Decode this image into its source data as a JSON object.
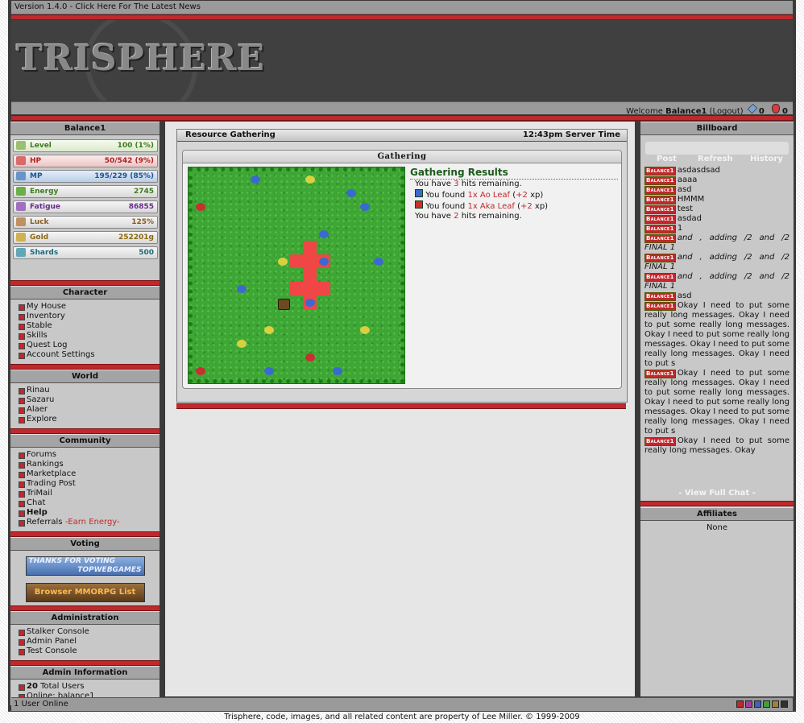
{
  "topbar": {
    "version_text": "Version 1.4.0 - Click Here For The Latest News"
  },
  "header": {
    "logo_text": "TRISPHERE"
  },
  "welcome": {
    "prefix": "Welcome",
    "user": "Balance1",
    "logout": "(Logout)",
    "crystal_count": "0",
    "potion_count": "0"
  },
  "left": {
    "player_name": "Balance1",
    "stats": [
      {
        "name": "Level",
        "value": "100 (1%)",
        "color": "#3e7a1e",
        "bg": "#e9f5dc"
      },
      {
        "name": "HP",
        "value": "50/542 (9%)",
        "color": "#b02020",
        "bg": "#f5d8d8"
      },
      {
        "name": "MP",
        "value": "195/229 (85%)",
        "color": "#24508c",
        "bg": "#cfe0f2"
      },
      {
        "name": "Energy",
        "value": "2745",
        "color": "#3e7a1e",
        "bg": "#e4efdc"
      },
      {
        "name": "Fatigue",
        "value": "86855",
        "color": "#6a2a8a",
        "bg": "#e6dcef"
      },
      {
        "name": "Luck",
        "value": "125%",
        "color": "#8a5a20",
        "bg": "#efe6dc"
      },
      {
        "name": "Gold",
        "value": "252201g",
        "color": "#8a6a10",
        "bg": "#efeadc"
      },
      {
        "name": "Shards",
        "value": "500",
        "color": "#1a6a7a",
        "bg": "#dcecef"
      }
    ],
    "character": {
      "title": "Character",
      "items": [
        "My House",
        "Inventory",
        "Stable",
        "Skills",
        "Quest Log",
        "Account Settings"
      ]
    },
    "world": {
      "title": "World",
      "items": [
        "Rinau",
        "Sazaru",
        "Alaer",
        "Explore"
      ]
    },
    "community": {
      "title": "Community",
      "items": [
        "Forums",
        "Rankings",
        "Marketplace",
        "Trading Post",
        "TriMail",
        "Chat",
        "Help",
        "Referrals"
      ],
      "referral_note": "-Earn Energy-"
    },
    "voting": {
      "title": "Voting",
      "banner1_line1": "THANKS FOR VOTING",
      "banner1_line2": "TOPWEBGAMES",
      "banner2": "Browser MMORPG List"
    },
    "administration": {
      "title": "Administration",
      "items": [
        "Stalker Console",
        "Admin Panel",
        "Test Console"
      ]
    },
    "admin_info": {
      "title": "Admin Information",
      "total_users_count": "20",
      "total_users_label": "Total Users",
      "online_label": "Online: balance1"
    }
  },
  "center": {
    "title": "Resource Gathering",
    "server_time": "12:43pm Server Time",
    "box_title": "Gathering",
    "results_title": "Gathering Results",
    "line1_pre": "You have",
    "line1_num": "3",
    "line1_post": "hits remaining.",
    "find1_pre": "You found",
    "find1_item": "1x Ao Leaf",
    "find1_open": "(",
    "find1_xp": "+2",
    "find1_post": "xp)",
    "find2_pre": "You found",
    "find2_item": "1x Aka Leaf",
    "find2_open": "(",
    "find2_xp": "+2",
    "find2_post": "xp)",
    "line2_pre": "You have",
    "line2_num": "2",
    "line2_post": "hits remaining."
  },
  "billboard": {
    "title": "Billboard",
    "tabs": [
      "Post",
      "Refresh",
      "History"
    ],
    "tag": "Balance1",
    "messages": [
      "asdasdsad",
      "aaaa",
      "asd",
      "HMMM",
      "test",
      "asdad",
      "1",
      "and , adding /2 and /2 FINAL 1",
      "and , adding /2 and /2 FINAL 1",
      "and , adding /2 and /2 FINAL 1",
      "asd",
      "Okay I need to put some really long messages. Okay I need to put some really long messages. Okay I need to put some really long messages. Okay I need to put some really long messages. Okay I need to put s",
      "Okay I need to put some really long messages. Okay I need to put some really long messages. Okay I need to put some really long messages. Okay I need to put some really long messages. Okay I need to put s",
      "Okay I need to put some really long messages. Okay"
    ],
    "view_full": "- View Full Chat -"
  },
  "affiliates": {
    "title": "Affiliates",
    "value": "None"
  },
  "bottom": {
    "users_online": "1 User Online"
  },
  "footer": {
    "text": "Trisphere, code, images, and all related content are property of Lee Miller. © 1999-2009"
  },
  "colors": {
    "accent_red": "#c0282b",
    "grass": "#3ea634",
    "highlight": "#f04646",
    "results_green": "#1c5a1c"
  }
}
